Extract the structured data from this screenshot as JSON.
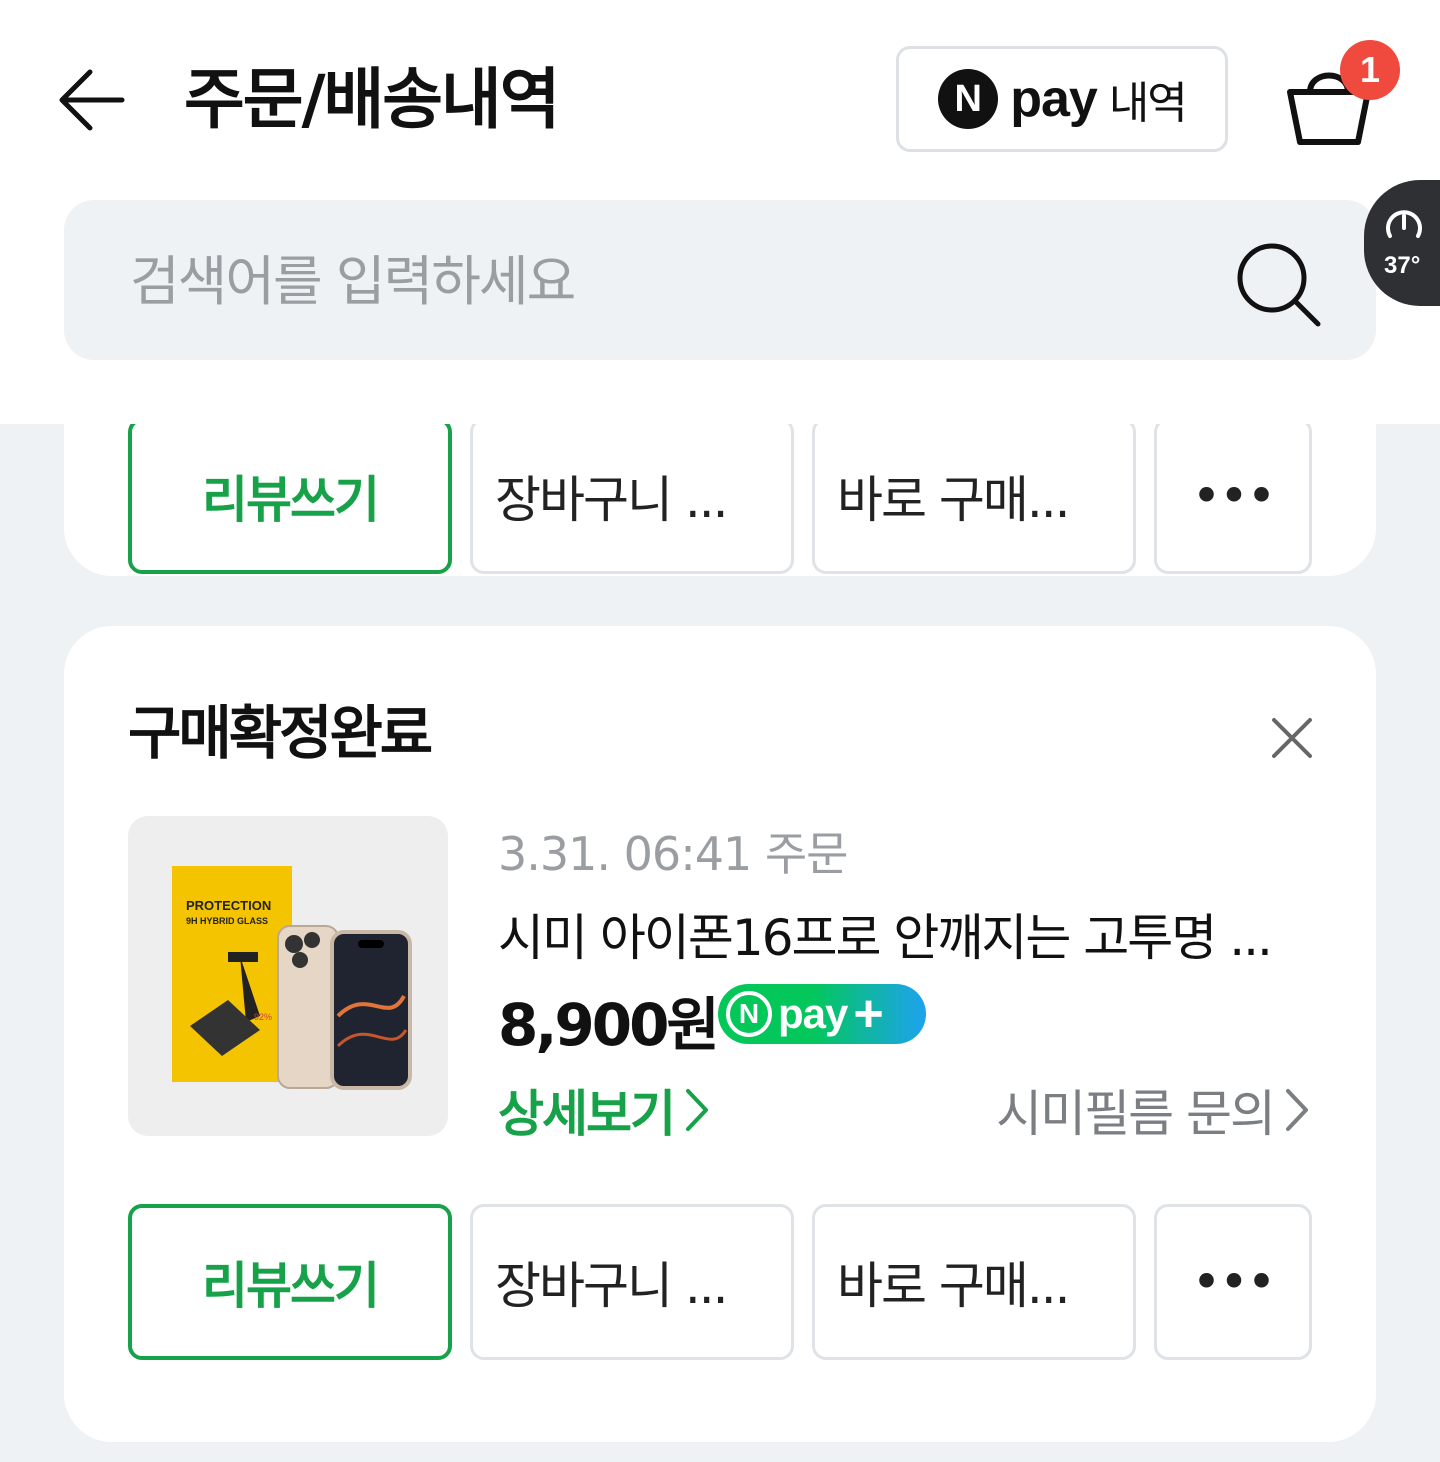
{
  "header": {
    "title": "주문/배송내역",
    "npay_logo_letter": "N",
    "npay_word": "pay",
    "npay_history_label": "내역",
    "cart_count": "1"
  },
  "search": {
    "placeholder": "검색어를 입력하세요"
  },
  "temperature_badge": {
    "value": "37°"
  },
  "top_card": {
    "actions": {
      "review": "리뷰쓰기",
      "cart": "장바구니 ...",
      "buy": "바로 구매...",
      "more": "•••"
    }
  },
  "order": {
    "status": "구매확정완료",
    "date": "3.31. 06:41 주문",
    "product_name": "시미 아이폰16프로 안깨지는 고투명 ...",
    "price": "8,900원",
    "npay_plus": {
      "letter": "N",
      "word": "pay",
      "sign": "+"
    },
    "detail_link": "상세보기",
    "seller_link": "시미필름 문의",
    "thumbnail": {
      "brand_line1": "PROTECTION",
      "brand_line2": "9H HYBRID GLASS",
      "badge": "92%"
    },
    "actions": {
      "review": "리뷰쓰기",
      "cart": "장바구니 ...",
      "buy": "바로 구매...",
      "more": "•••"
    }
  },
  "colors": {
    "accent_green": "#17a24a",
    "badge_red": "#f04a3e",
    "background": "#eef2f5"
  }
}
